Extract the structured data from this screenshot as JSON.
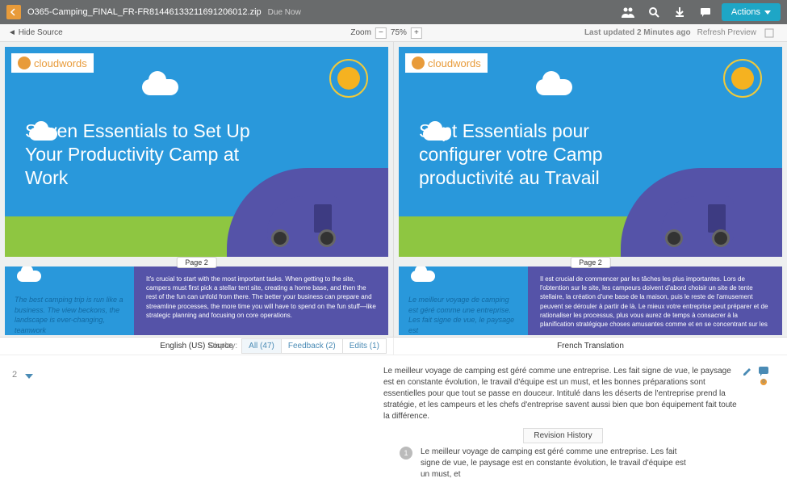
{
  "topbar": {
    "filename": "O365-Camping_FINAL_FR-FR81446133211691206012.zip",
    "due": "Due Now",
    "actions": "Actions"
  },
  "subbar": {
    "hide_source": "Hide Source",
    "zoom_label": "Zoom",
    "zoom_value": "75%",
    "updated": "Last updated 2 Minutes ago",
    "refresh": "Refresh Preview"
  },
  "preview": {
    "logo": "cloudwords",
    "page_tag": "Page 2",
    "source_title": "Seven Essentials to Set Up Your Productivity Camp at Work",
    "target_title": "Sept Essentials pour configurer votre Camp productivité au Travail",
    "source_p2_left": "The best camping trip is run like a business. The view beckons, the landscape is ever-changing, teamwork",
    "source_p2_right": "It's crucial to start with the most important tasks. When getting to the site, campers must first pick a stellar tent site, creating a home base, and then the rest of the fun can unfold from there. The better your business can prepare and streamline processes, the more time you will have to spend on the fun stuff—like strategic planning and focusing on core operations.",
    "target_p2_left": "Le meilleur voyage de camping est géré comme une entreprise. Les fait signe de vue, le paysage est",
    "target_p2_right": "Il est crucial de commencer par les tâches les plus importantes. Lors de l'obtention sur le site, les campeurs doivent d'abord choisir un site de tente stellaire, la création d'une base de la maison, puis le reste de l'amusement peuvent se dérouler à partir de là. Le mieux votre entreprise peut préparer et de rationaliser les processus, plus vous aurez de temps à consacrer à la planification stratégique choses amusantes comme et en se concentrant sur les"
  },
  "panel": {
    "source_lang": "English (US) Source",
    "target_lang": "French Translation",
    "display_label": "Display:",
    "filter_all": "All (47)",
    "filter_feedback": "Feedback (2)",
    "filter_edits": "Edits (1)",
    "seg_num": "2",
    "translation": "Le meilleur voyage de camping est géré comme une entreprise. Les fait signe de vue, le paysage est en constante évolution, le travail d'équipe est un must, et les bonnes préparations sont essentielles pour que tout se passe en douceur. Intitulé dans les déserts de l'entreprise prend la stratégie, et les campeurs et les chefs d'entreprise savent aussi bien que bon équipement fait toute la différence.",
    "rev_label": "Revision History",
    "rev_badge": "1",
    "rev_text": "Le meilleur voyage de camping est géré comme une entreprise. Les fait signe de vue, le paysage est en constante évolution, le travail d'équipe est un must, et"
  }
}
